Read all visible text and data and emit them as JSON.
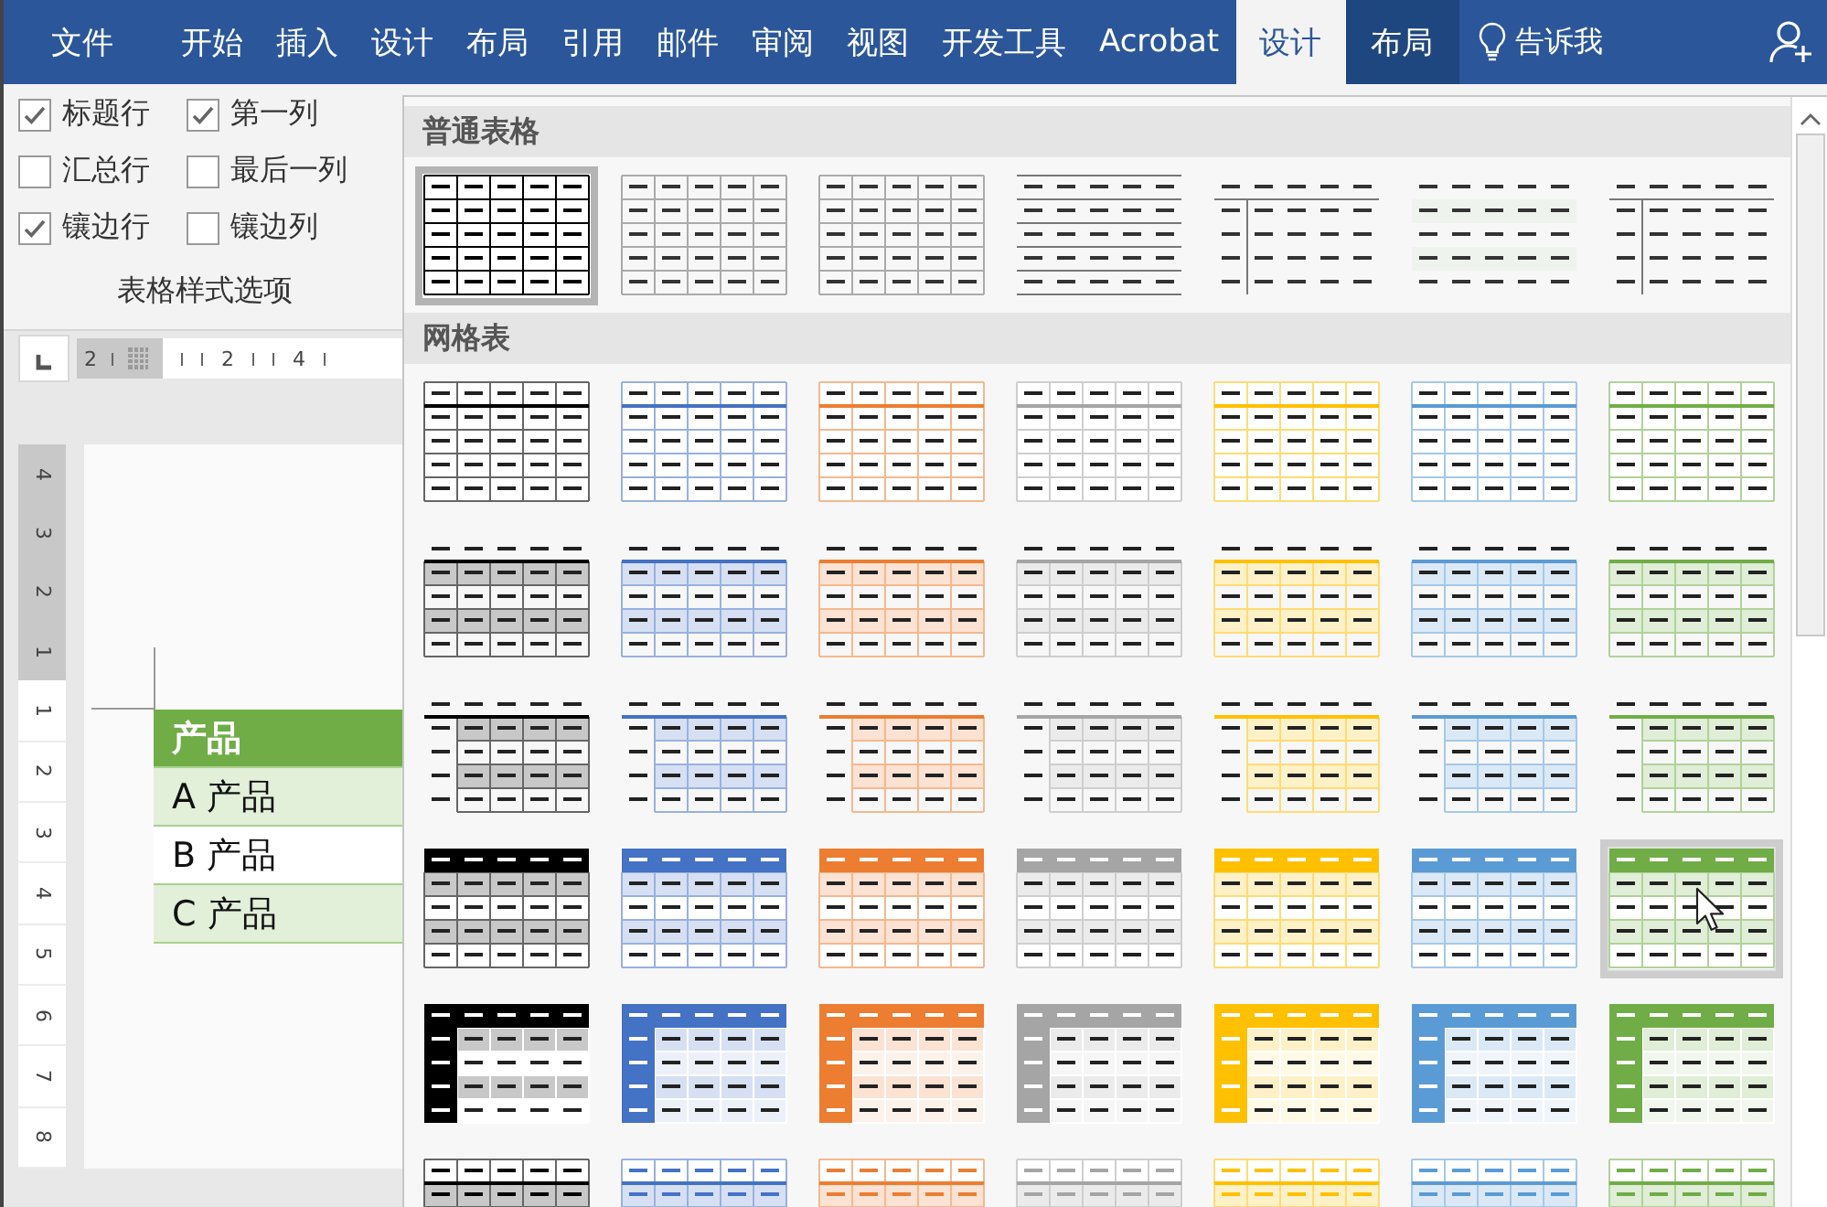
{
  "tabs": [
    {
      "label": "文件",
      "selected": false,
      "contextual": false
    },
    {
      "label": "开始",
      "selected": false,
      "contextual": false
    },
    {
      "label": "插入",
      "selected": false,
      "contextual": false
    },
    {
      "label": "设计",
      "selected": false,
      "contextual": false
    },
    {
      "label": "布局",
      "selected": false,
      "contextual": false
    },
    {
      "label": "引用",
      "selected": false,
      "contextual": false
    },
    {
      "label": "邮件",
      "selected": false,
      "contextual": false
    },
    {
      "label": "审阅",
      "selected": false,
      "contextual": false
    },
    {
      "label": "视图",
      "selected": false,
      "contextual": false
    },
    {
      "label": "开发工具",
      "selected": false,
      "contextual": false
    },
    {
      "label": "Acrobat",
      "selected": false,
      "contextual": false
    },
    {
      "label": "设计",
      "selected": true,
      "contextual": true
    },
    {
      "label": "布局",
      "selected": false,
      "contextual": true
    }
  ],
  "tell_me": {
    "label": "告诉我"
  },
  "style_options": {
    "checkboxes": [
      {
        "label": "标题行",
        "checked": true
      },
      {
        "label": "第一列",
        "checked": true
      },
      {
        "label": "汇总行",
        "checked": false
      },
      {
        "label": "最后一列",
        "checked": false
      },
      {
        "label": "镶边行",
        "checked": true
      },
      {
        "label": "镶边列",
        "checked": false
      }
    ],
    "group_label": "表格样式选项"
  },
  "horizontal_ruler": {
    "labels": [
      "2",
      "2",
      "4"
    ]
  },
  "vertical_ruler": {
    "labels": [
      "4",
      "3",
      "2",
      "1",
      "1",
      "2",
      "3",
      "4",
      "5",
      "6",
      "7",
      "8"
    ]
  },
  "document_table": {
    "rows": [
      {
        "text": "产品",
        "kind": "header"
      },
      {
        "text": "A 产品",
        "kind": "banded"
      },
      {
        "text": "B 产品",
        "kind": "plain"
      },
      {
        "text": "C 产品",
        "kind": "banded"
      }
    ]
  },
  "gallery": {
    "sections": [
      {
        "title": "普通表格",
        "rows": [
          [
            {
              "kind": "grid",
              "selected": true,
              "hovered": false
            },
            {
              "kind": "light-grid",
              "selected": false,
              "hovered": false
            },
            {
              "kind": "light-grid",
              "selected": false,
              "hovered": false
            },
            {
              "kind": "horizontal-rules",
              "selected": false,
              "hovered": false
            },
            {
              "kind": "header-col-rule",
              "selected": false,
              "hovered": false
            },
            {
              "kind": "dashes-banded",
              "selected": false,
              "hovered": false
            },
            {
              "kind": "header-col-rule",
              "selected": false,
              "hovered": false
            }
          ]
        ]
      },
      {
        "title": "网格表",
        "rows": [
          [
            {
              "kind": "grid-header",
              "color": "#000000",
              "selected": false,
              "hovered": false
            },
            {
              "kind": "grid-header",
              "color": "#4472c4",
              "selected": false,
              "hovered": false
            },
            {
              "kind": "grid-header",
              "color": "#ed7d31",
              "selected": false,
              "hovered": false
            },
            {
              "kind": "grid-header",
              "color": "#a5a5a5",
              "selected": false,
              "hovered": false
            },
            {
              "kind": "grid-header",
              "color": "#ffc000",
              "selected": false,
              "hovered": false
            },
            {
              "kind": "grid-header",
              "color": "#5b9bd5",
              "selected": false,
              "hovered": false
            },
            {
              "kind": "grid-header",
              "color": "#70ad47",
              "selected": false,
              "hovered": false
            }
          ],
          [
            {
              "kind": "banded-grid",
              "color": "#000000",
              "selected": false,
              "hovered": false
            },
            {
              "kind": "banded-grid",
              "color": "#4472c4",
              "selected": false,
              "hovered": false
            },
            {
              "kind": "banded-grid",
              "color": "#ed7d31",
              "selected": false,
              "hovered": false
            },
            {
              "kind": "banded-grid",
              "color": "#a5a5a5",
              "selected": false,
              "hovered": false
            },
            {
              "kind": "banded-grid",
              "color": "#ffc000",
              "selected": false,
              "hovered": false
            },
            {
              "kind": "banded-grid",
              "color": "#5b9bd5",
              "selected": false,
              "hovered": false
            },
            {
              "kind": "banded-grid",
              "color": "#70ad47",
              "selected": false,
              "hovered": false
            }
          ],
          [
            {
              "kind": "banded-first-col",
              "color": "#000000",
              "selected": false,
              "hovered": false
            },
            {
              "kind": "banded-first-col",
              "color": "#4472c4",
              "selected": false,
              "hovered": false
            },
            {
              "kind": "banded-first-col",
              "color": "#ed7d31",
              "selected": false,
              "hovered": false
            },
            {
              "kind": "banded-first-col",
              "color": "#a5a5a5",
              "selected": false,
              "hovered": false
            },
            {
              "kind": "banded-first-col",
              "color": "#ffc000",
              "selected": false,
              "hovered": false
            },
            {
              "kind": "banded-first-col",
              "color": "#5b9bd5",
              "selected": false,
              "hovered": false
            },
            {
              "kind": "banded-first-col",
              "color": "#70ad47",
              "selected": false,
              "hovered": false
            }
          ],
          [
            {
              "kind": "header-filled",
              "color": "#000000",
              "selected": false,
              "hovered": false
            },
            {
              "kind": "header-filled",
              "color": "#4472c4",
              "selected": false,
              "hovered": false
            },
            {
              "kind": "header-filled",
              "color": "#ed7d31",
              "selected": false,
              "hovered": false
            },
            {
              "kind": "header-filled",
              "color": "#a5a5a5",
              "selected": false,
              "hovered": false
            },
            {
              "kind": "header-filled",
              "color": "#ffc000",
              "selected": false,
              "hovered": false
            },
            {
              "kind": "header-filled",
              "color": "#5b9bd5",
              "selected": false,
              "hovered": false
            },
            {
              "kind": "header-filled",
              "color": "#70ad47",
              "selected": false,
              "hovered": true
            }
          ],
          [
            {
              "kind": "header-col-filled",
              "color": "#000000",
              "selected": false,
              "hovered": false
            },
            {
              "kind": "header-col-filled",
              "color": "#4472c4",
              "selected": false,
              "hovered": false
            },
            {
              "kind": "header-col-filled",
              "color": "#ed7d31",
              "selected": false,
              "hovered": false
            },
            {
              "kind": "header-col-filled",
              "color": "#a5a5a5",
              "selected": false,
              "hovered": false
            },
            {
              "kind": "header-col-filled",
              "color": "#ffc000",
              "selected": false,
              "hovered": false
            },
            {
              "kind": "header-col-filled",
              "color": "#5b9bd5",
              "selected": false,
              "hovered": false
            },
            {
              "kind": "header-col-filled",
              "color": "#70ad47",
              "selected": false,
              "hovered": false
            }
          ],
          [
            {
              "kind": "colored-dashes",
              "color": "#000000",
              "selected": false,
              "hovered": false
            },
            {
              "kind": "colored-dashes",
              "color": "#4472c4",
              "selected": false,
              "hovered": false
            },
            {
              "kind": "colored-dashes",
              "color": "#ed7d31",
              "selected": false,
              "hovered": false
            },
            {
              "kind": "colored-dashes",
              "color": "#a5a5a5",
              "selected": false,
              "hovered": false
            },
            {
              "kind": "colored-dashes",
              "color": "#ffc000",
              "selected": false,
              "hovered": false
            },
            {
              "kind": "colored-dashes",
              "color": "#5b9bd5",
              "selected": false,
              "hovered": false
            },
            {
              "kind": "colored-dashes",
              "color": "#70ad47",
              "selected": false,
              "hovered": false
            }
          ]
        ]
      }
    ]
  }
}
